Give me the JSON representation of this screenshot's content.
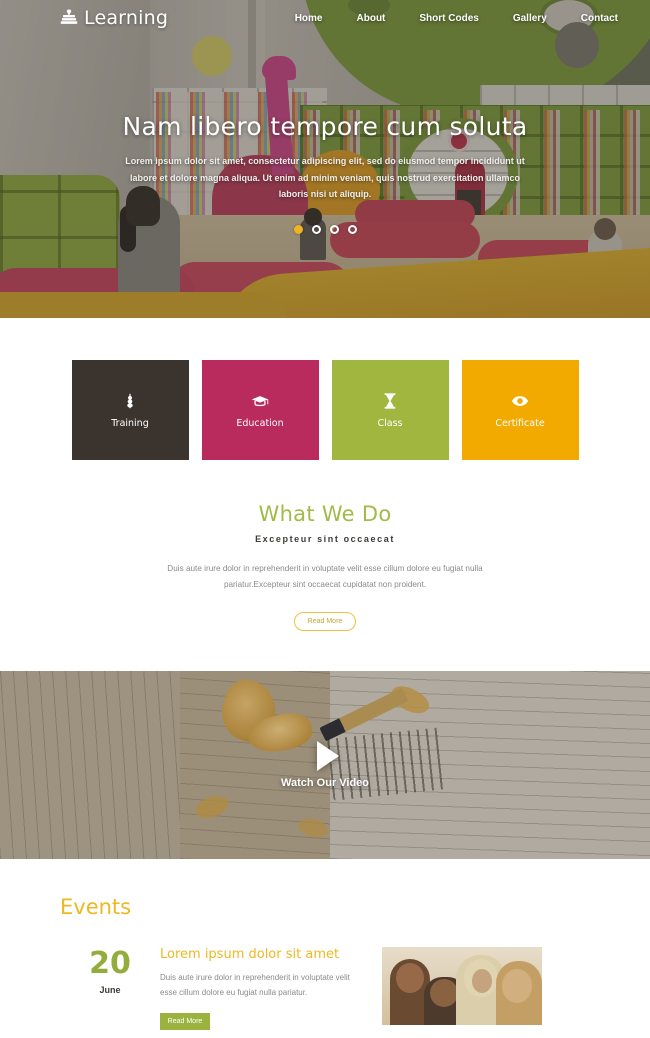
{
  "header": {
    "logo_text": "Learning",
    "logo_icon": "books-stack-icon",
    "nav": [
      {
        "label": "Home"
      },
      {
        "label": "About"
      },
      {
        "label": "Short Codes"
      },
      {
        "label": "Gallery"
      },
      {
        "label": "Contact"
      }
    ]
  },
  "hero": {
    "title": "Nam libero tempore cum soluta",
    "subtitle": "Lorem ipsum dolor sit amet, consectetur adipiscing elit, sed do eiusmod tempor incididunt ut labore et dolore magna aliqua. Ut enim ad minim veniam, quis nostrud exercitation ullamco laboris nisi ut aliquip.",
    "slide_count": 4,
    "active_slide": 1,
    "active_dot_color": "#f0b323"
  },
  "services": [
    {
      "label": "Training",
      "icon": "wheat-plant-icon",
      "color": "#3b342e"
    },
    {
      "label": "Education",
      "icon": "graduation-cap-icon",
      "color": "#b92a5d"
    },
    {
      "label": "Class",
      "icon": "hourglass-icon",
      "color": "#a0b63f"
    },
    {
      "label": "Certificate",
      "icon": "eye-icon",
      "color": "#f2a900"
    }
  ],
  "what_we_do": {
    "title": "What We Do",
    "subtitle": "Excepteur sint occaecat",
    "body": "Duis aute irure dolor in reprehenderit in voluptate velit esse cillum dolore eu fugiat nulla pariatur.Excepteur sint occaecat cupidatat non proident.",
    "button_label": "Read More",
    "title_color": "#a2ba48",
    "button_border_color": "#f0c040"
  },
  "video": {
    "label": "Watch Our Video",
    "play_icon": "play-triangle-icon"
  },
  "events": {
    "title": "Events",
    "title_color": "#eeb821",
    "items": [
      {
        "day": "20",
        "month": "June",
        "title": "Lorem ipsum dolor sit amet",
        "text": "Duis aute irure dolor in reprehenderit in voluptate velit esse cillum dolore eu fugiat nulla pariatur.",
        "button_label": "Read More",
        "day_color": "#93ad3c",
        "button_color": "#9bb33e",
        "thumbnail": "students-studying-photo"
      }
    ]
  }
}
